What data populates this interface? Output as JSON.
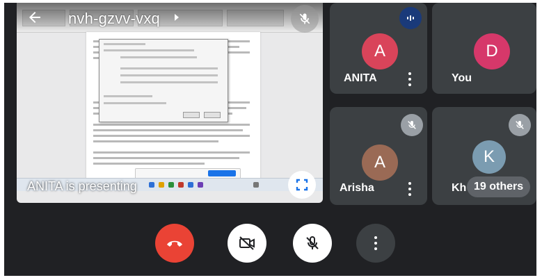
{
  "header": {
    "meeting_code": "nvh-gzvv-vxq",
    "back_icon": "arrow-left-icon",
    "chevron_icon": "chevron-right-icon",
    "switch_camera_icon": "switch-camera-icon",
    "speaker_icon": "speaker-icon"
  },
  "presentation": {
    "label": "ANITA is presenting",
    "mic_icon": "mic-off-icon",
    "fullscreen_icon": "fullscreen-icon"
  },
  "participants": [
    {
      "name": "ANITA",
      "initial": "A",
      "avatar_color": "#d9445a",
      "speaking": true
    },
    {
      "name": "You",
      "initial": "D",
      "avatar_color": "#d6386a",
      "muted": false
    },
    {
      "name": "Arisha",
      "initial": "A",
      "avatar_color": "#9a6a55",
      "muted": true
    },
    {
      "name": "Kh",
      "initial": "K",
      "avatar_color": "#7b9cb1",
      "muted": true
    }
  ],
  "others": {
    "label": "19 others"
  },
  "controls": {
    "end_call_icon": "phone-hangup-icon",
    "camera_icon": "camera-off-icon",
    "mic_icon": "mic-off-icon",
    "more_icon": "more-vert-icon"
  },
  "colors": {
    "background": "#202124",
    "tile": "#3c4043",
    "end_call": "#ea4335",
    "speaking_badge": "#1a3a7a"
  }
}
